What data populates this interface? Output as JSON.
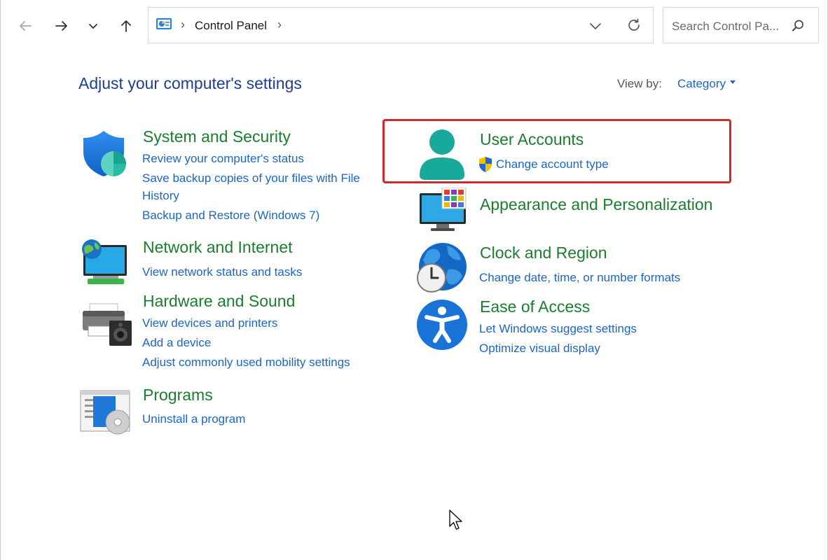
{
  "nav": {
    "back_icon": "arrow-left-icon",
    "forward_icon": "arrow-right-icon",
    "recent_icon": "chevron-down-icon",
    "up_icon": "arrow-up-icon"
  },
  "address": {
    "breadcrumb": "Control Panel",
    "separator": "›"
  },
  "search": {
    "placeholder": "Search Control Pa..."
  },
  "page": {
    "heading": "Adjust your computer's settings",
    "view_by_label": "View by:",
    "view_by_value": "Category"
  },
  "categories": {
    "system": {
      "title": "System and Security",
      "links": [
        "Review your computer's status",
        "Save backup copies of your files with File",
        "History",
        "Backup and Restore (Windows 7)"
      ]
    },
    "network": {
      "title": "Network and Internet",
      "links": [
        "View network status and tasks"
      ]
    },
    "hardware": {
      "title": "Hardware and Sound",
      "links": [
        "View devices and printers",
        "Add a device",
        "Adjust commonly used mobility settings"
      ]
    },
    "programs": {
      "title": "Programs",
      "links": [
        "Uninstall a program"
      ]
    },
    "user": {
      "title": "User Accounts",
      "links": [
        "Change account type"
      ]
    },
    "appearance": {
      "title": "Appearance and Personalization",
      "links": []
    },
    "clock": {
      "title": "Clock and Region",
      "links": [
        "Change date, time, or number formats"
      ]
    },
    "ease": {
      "title": "Ease of Access",
      "links": [
        "Let Windows suggest settings",
        "Optimize visual display"
      ]
    }
  },
  "colors": {
    "heading": "#1c3f95",
    "category_title": "#1a7e2e",
    "link": "#1a66c8",
    "highlight": "#d12a2a"
  }
}
